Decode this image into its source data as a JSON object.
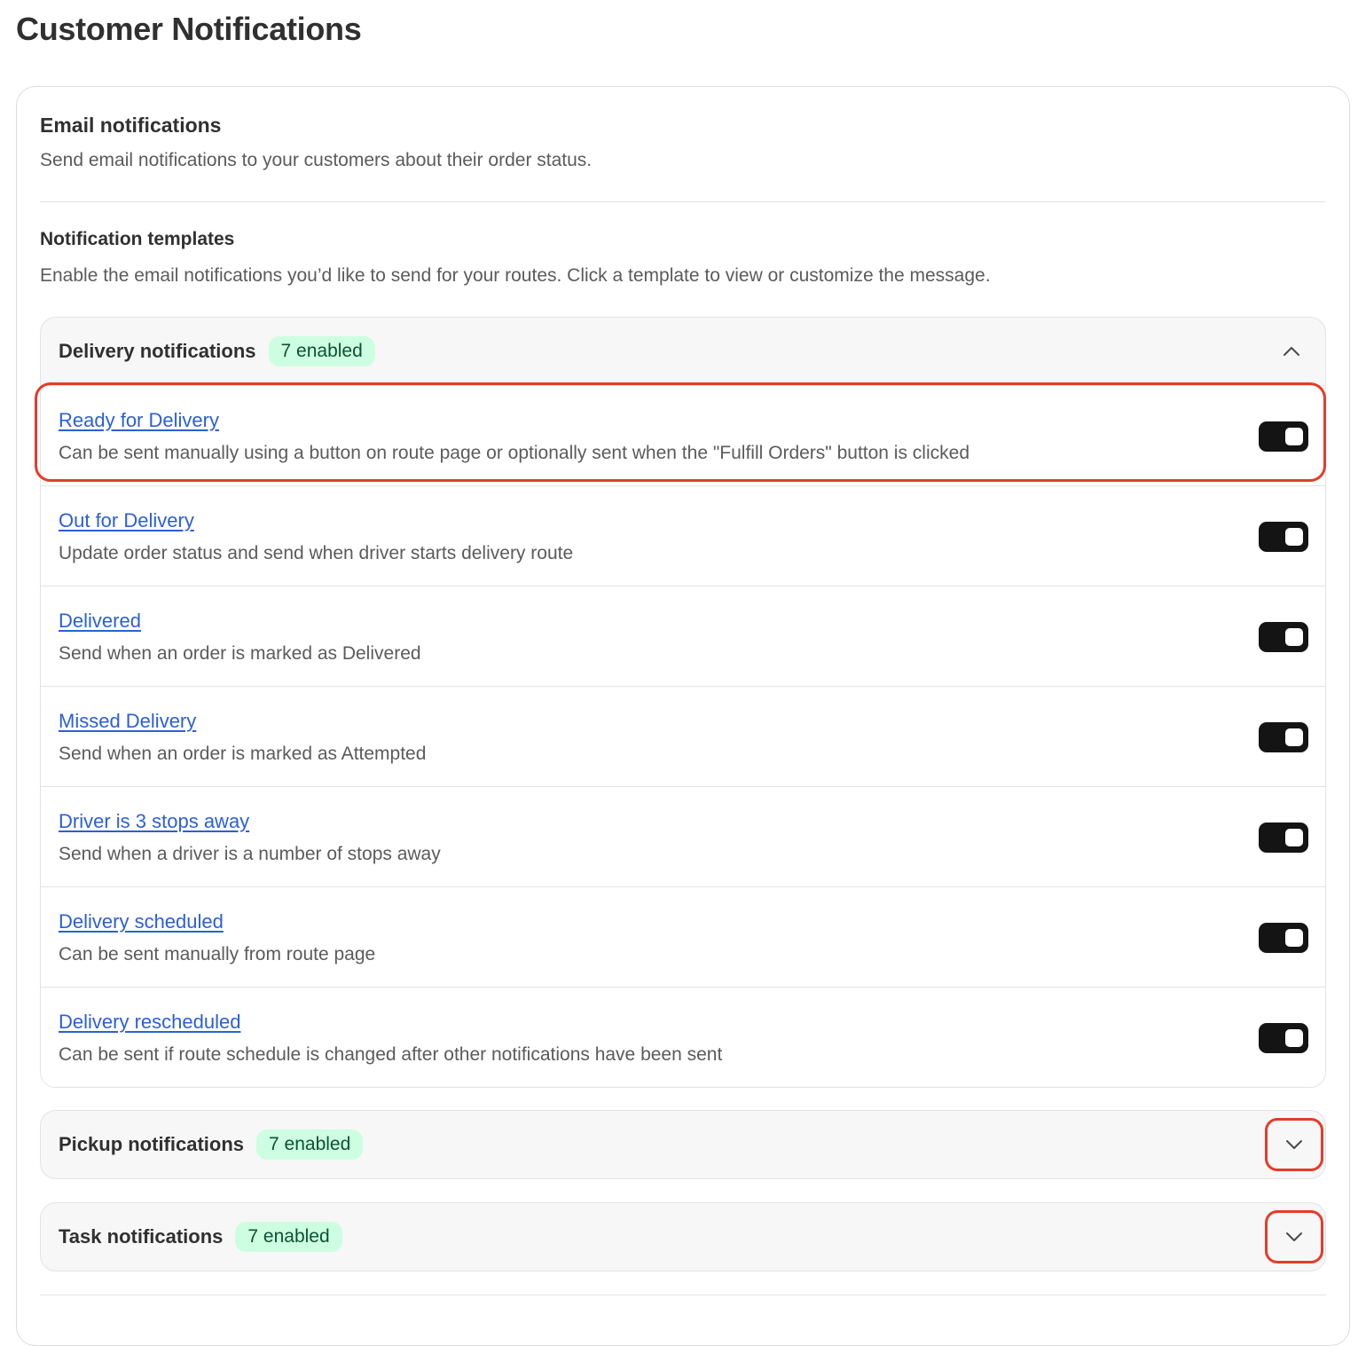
{
  "page": {
    "title": "Customer Notifications"
  },
  "email": {
    "title": "Email notifications",
    "description": "Send email notifications to your customers about their order status."
  },
  "templates": {
    "title": "Notification templates",
    "description": "Enable the email notifications you’d like to send for your routes. Click a template to view or customize the message."
  },
  "groups": {
    "delivery": {
      "title": "Delivery notifications",
      "badge": "7 enabled",
      "expanded": true,
      "items": [
        {
          "label": "Ready for Delivery",
          "description": "Can be sent manually using a button on route page or optionally sent when the \"Fulfill Orders\" button is clicked",
          "enabled": true
        },
        {
          "label": "Out for Delivery",
          "description": "Update order status and send when driver starts delivery route",
          "enabled": true
        },
        {
          "label": "Delivered",
          "description": "Send when an order is marked as Delivered",
          "enabled": true
        },
        {
          "label": "Missed Delivery",
          "description": "Send when an order is marked as Attempted",
          "enabled": true
        },
        {
          "label": "Driver is 3 stops away",
          "description": "Send when a driver is a number of stops away",
          "enabled": true
        },
        {
          "label": "Delivery scheduled",
          "description": "Can be sent manually from route page",
          "enabled": true
        },
        {
          "label": "Delivery rescheduled",
          "description": "Can be sent if route schedule is changed after other notifications have been sent",
          "enabled": true
        }
      ]
    },
    "pickup": {
      "title": "Pickup notifications",
      "badge": "7 enabled",
      "expanded": false
    },
    "task": {
      "title": "Task notifications",
      "badge": "7 enabled",
      "expanded": false
    }
  },
  "colors": {
    "highlight": "#e53b2a",
    "badge_bg": "#cdfee1",
    "badge_text": "#0c5132",
    "link": "#2c5fd6",
    "toggle_on": "#141414"
  },
  "icons": {
    "collapse": "chevron-up-icon",
    "expand": "chevron-down-icon"
  }
}
